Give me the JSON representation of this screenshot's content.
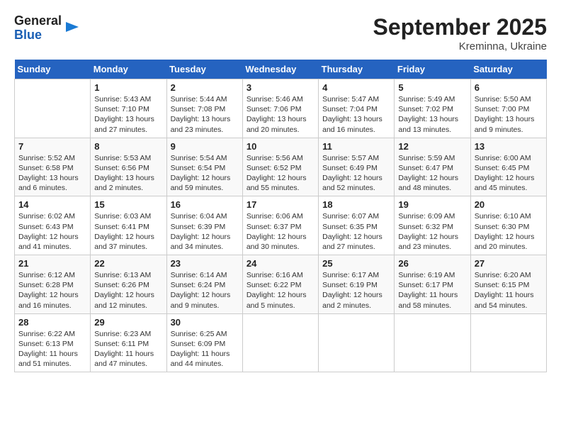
{
  "header": {
    "logo_line1": "General",
    "logo_line2": "Blue",
    "month": "September 2025",
    "location": "Kreminna, Ukraine"
  },
  "days_of_week": [
    "Sunday",
    "Monday",
    "Tuesday",
    "Wednesday",
    "Thursday",
    "Friday",
    "Saturday"
  ],
  "weeks": [
    [
      {
        "day": "",
        "info": ""
      },
      {
        "day": "1",
        "info": "Sunrise: 5:43 AM\nSunset: 7:10 PM\nDaylight: 13 hours\nand 27 minutes."
      },
      {
        "day": "2",
        "info": "Sunrise: 5:44 AM\nSunset: 7:08 PM\nDaylight: 13 hours\nand 23 minutes."
      },
      {
        "day": "3",
        "info": "Sunrise: 5:46 AM\nSunset: 7:06 PM\nDaylight: 13 hours\nand 20 minutes."
      },
      {
        "day": "4",
        "info": "Sunrise: 5:47 AM\nSunset: 7:04 PM\nDaylight: 13 hours\nand 16 minutes."
      },
      {
        "day": "5",
        "info": "Sunrise: 5:49 AM\nSunset: 7:02 PM\nDaylight: 13 hours\nand 13 minutes."
      },
      {
        "day": "6",
        "info": "Sunrise: 5:50 AM\nSunset: 7:00 PM\nDaylight: 13 hours\nand 9 minutes."
      }
    ],
    [
      {
        "day": "7",
        "info": "Sunrise: 5:52 AM\nSunset: 6:58 PM\nDaylight: 13 hours\nand 6 minutes."
      },
      {
        "day": "8",
        "info": "Sunrise: 5:53 AM\nSunset: 6:56 PM\nDaylight: 13 hours\nand 2 minutes."
      },
      {
        "day": "9",
        "info": "Sunrise: 5:54 AM\nSunset: 6:54 PM\nDaylight: 12 hours\nand 59 minutes."
      },
      {
        "day": "10",
        "info": "Sunrise: 5:56 AM\nSunset: 6:52 PM\nDaylight: 12 hours\nand 55 minutes."
      },
      {
        "day": "11",
        "info": "Sunrise: 5:57 AM\nSunset: 6:49 PM\nDaylight: 12 hours\nand 52 minutes."
      },
      {
        "day": "12",
        "info": "Sunrise: 5:59 AM\nSunset: 6:47 PM\nDaylight: 12 hours\nand 48 minutes."
      },
      {
        "day": "13",
        "info": "Sunrise: 6:00 AM\nSunset: 6:45 PM\nDaylight: 12 hours\nand 45 minutes."
      }
    ],
    [
      {
        "day": "14",
        "info": "Sunrise: 6:02 AM\nSunset: 6:43 PM\nDaylight: 12 hours\nand 41 minutes."
      },
      {
        "day": "15",
        "info": "Sunrise: 6:03 AM\nSunset: 6:41 PM\nDaylight: 12 hours\nand 37 minutes."
      },
      {
        "day": "16",
        "info": "Sunrise: 6:04 AM\nSunset: 6:39 PM\nDaylight: 12 hours\nand 34 minutes."
      },
      {
        "day": "17",
        "info": "Sunrise: 6:06 AM\nSunset: 6:37 PM\nDaylight: 12 hours\nand 30 minutes."
      },
      {
        "day": "18",
        "info": "Sunrise: 6:07 AM\nSunset: 6:35 PM\nDaylight: 12 hours\nand 27 minutes."
      },
      {
        "day": "19",
        "info": "Sunrise: 6:09 AM\nSunset: 6:32 PM\nDaylight: 12 hours\nand 23 minutes."
      },
      {
        "day": "20",
        "info": "Sunrise: 6:10 AM\nSunset: 6:30 PM\nDaylight: 12 hours\nand 20 minutes."
      }
    ],
    [
      {
        "day": "21",
        "info": "Sunrise: 6:12 AM\nSunset: 6:28 PM\nDaylight: 12 hours\nand 16 minutes."
      },
      {
        "day": "22",
        "info": "Sunrise: 6:13 AM\nSunset: 6:26 PM\nDaylight: 12 hours\nand 12 minutes."
      },
      {
        "day": "23",
        "info": "Sunrise: 6:14 AM\nSunset: 6:24 PM\nDaylight: 12 hours\nand 9 minutes."
      },
      {
        "day": "24",
        "info": "Sunrise: 6:16 AM\nSunset: 6:22 PM\nDaylight: 12 hours\nand 5 minutes."
      },
      {
        "day": "25",
        "info": "Sunrise: 6:17 AM\nSunset: 6:19 PM\nDaylight: 12 hours\nand 2 minutes."
      },
      {
        "day": "26",
        "info": "Sunrise: 6:19 AM\nSunset: 6:17 PM\nDaylight: 11 hours\nand 58 minutes."
      },
      {
        "day": "27",
        "info": "Sunrise: 6:20 AM\nSunset: 6:15 PM\nDaylight: 11 hours\nand 54 minutes."
      }
    ],
    [
      {
        "day": "28",
        "info": "Sunrise: 6:22 AM\nSunset: 6:13 PM\nDaylight: 11 hours\nand 51 minutes."
      },
      {
        "day": "29",
        "info": "Sunrise: 6:23 AM\nSunset: 6:11 PM\nDaylight: 11 hours\nand 47 minutes."
      },
      {
        "day": "30",
        "info": "Sunrise: 6:25 AM\nSunset: 6:09 PM\nDaylight: 11 hours\nand 44 minutes."
      },
      {
        "day": "",
        "info": ""
      },
      {
        "day": "",
        "info": ""
      },
      {
        "day": "",
        "info": ""
      },
      {
        "day": "",
        "info": ""
      }
    ]
  ]
}
